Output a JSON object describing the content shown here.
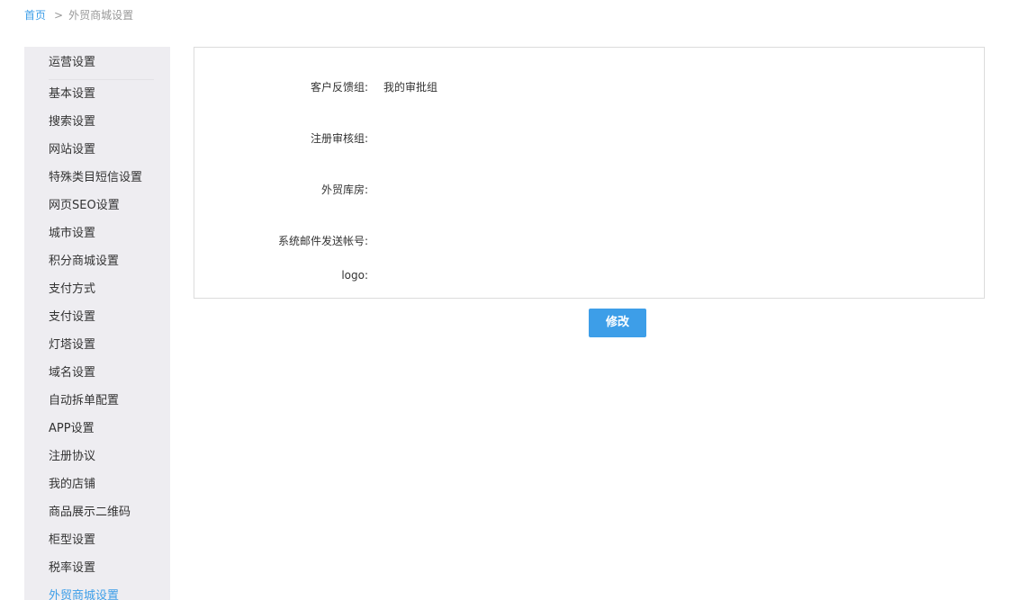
{
  "breadcrumb": {
    "home": "首页",
    "separator": ">",
    "current": "外贸商城设置"
  },
  "sidebar": {
    "header": "运营设置",
    "items": [
      {
        "label": "基本设置",
        "active": false
      },
      {
        "label": "搜索设置",
        "active": false
      },
      {
        "label": "网站设置",
        "active": false
      },
      {
        "label": "特殊类目短信设置",
        "active": false
      },
      {
        "label": "网页SEO设置",
        "active": false
      },
      {
        "label": "城市设置",
        "active": false
      },
      {
        "label": "积分商城设置",
        "active": false
      },
      {
        "label": "支付方式",
        "active": false
      },
      {
        "label": "支付设置",
        "active": false
      },
      {
        "label": "灯塔设置",
        "active": false
      },
      {
        "label": "域名设置",
        "active": false
      },
      {
        "label": "自动拆单配置",
        "active": false
      },
      {
        "label": "APP设置",
        "active": false
      },
      {
        "label": "注册协议",
        "active": false
      },
      {
        "label": "我的店铺",
        "active": false
      },
      {
        "label": "商品展示二维码",
        "active": false
      },
      {
        "label": "柜型设置",
        "active": false
      },
      {
        "label": "税率设置",
        "active": false
      },
      {
        "label": "外贸商城设置",
        "active": true
      }
    ]
  },
  "form": {
    "fields": [
      {
        "label": "客户反馈组:",
        "value": "我的审批组"
      },
      {
        "label": "注册审核组:",
        "value": ""
      },
      {
        "label": "外贸库房:",
        "value": ""
      },
      {
        "label": "系统邮件发送帐号:",
        "value": ""
      },
      {
        "label": "logo:",
        "value": ""
      }
    ],
    "submit_label": "修改"
  },
  "colors": {
    "accent": "#3d9ee8",
    "sidebar_bg": "#eeedf1",
    "panel_border": "#dcdcdc"
  }
}
